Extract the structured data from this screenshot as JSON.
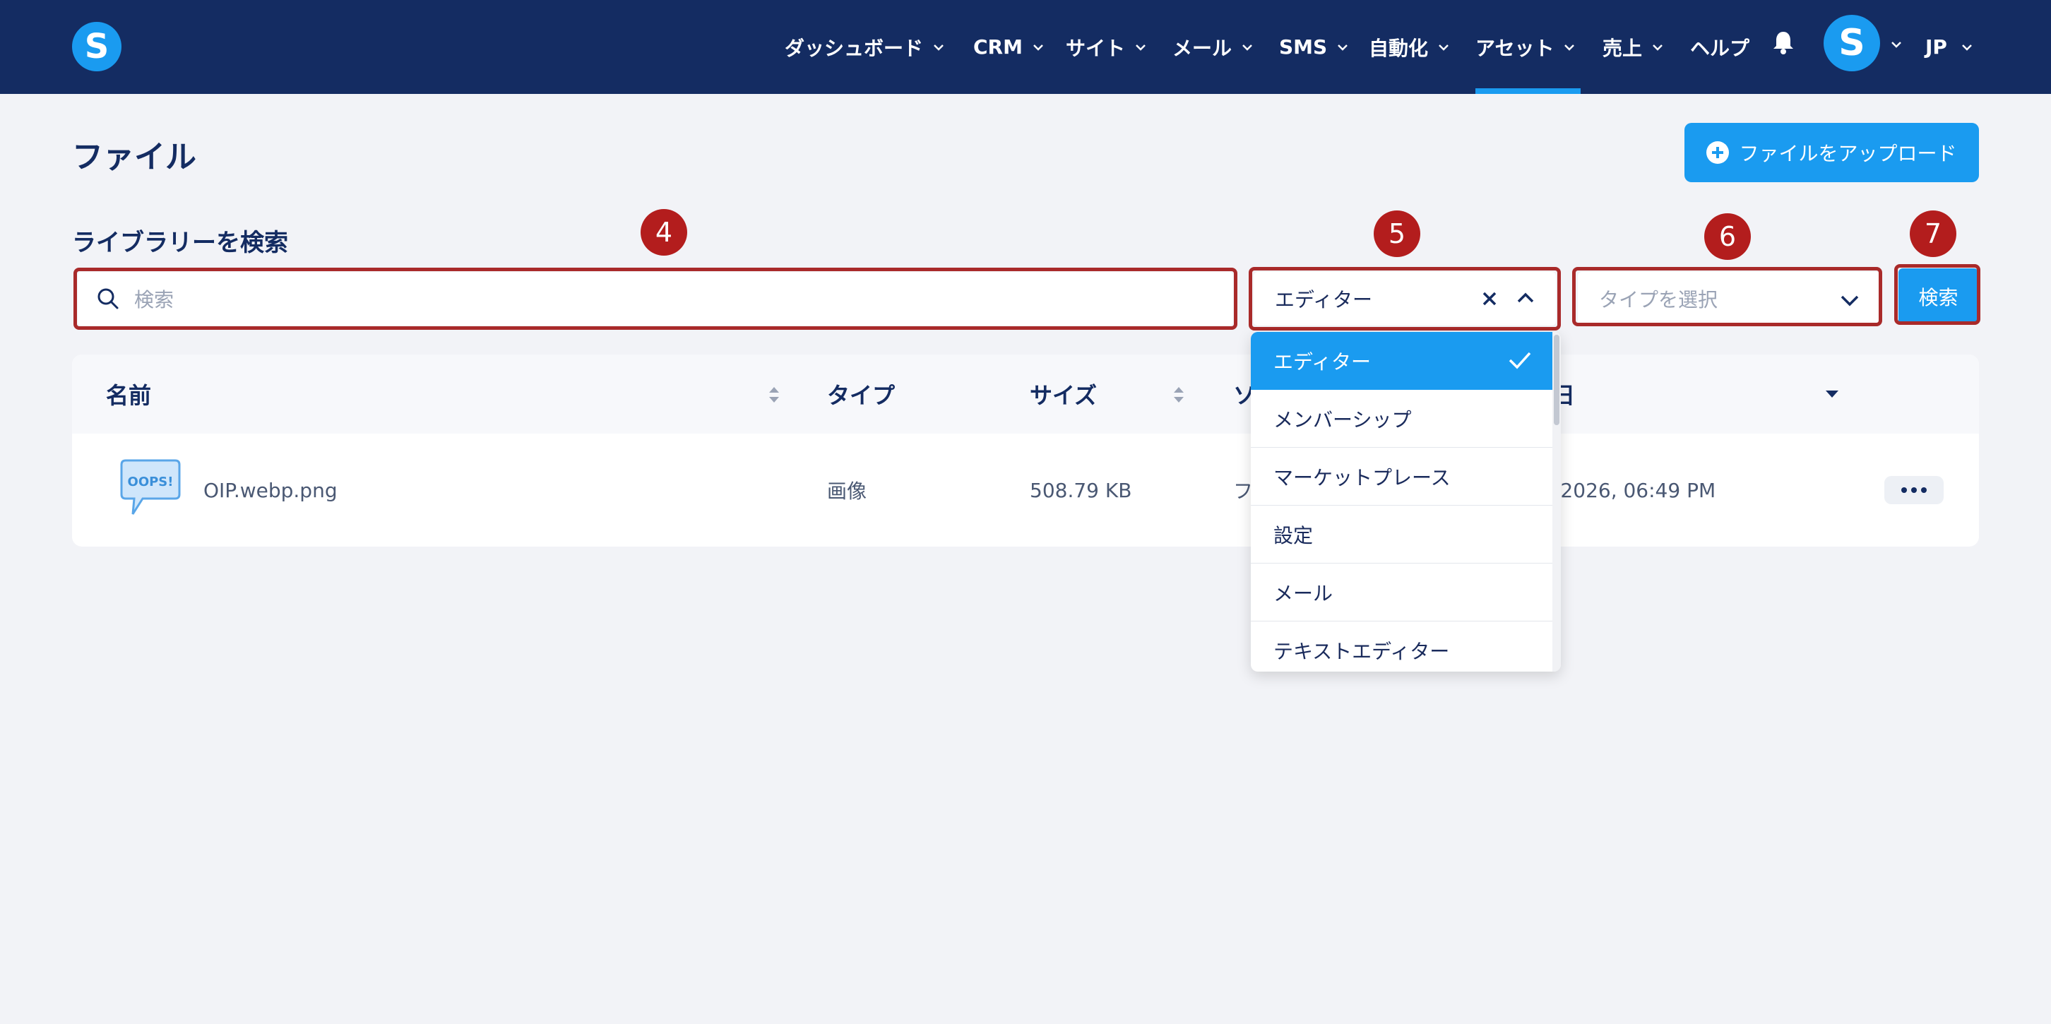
{
  "header": {
    "logo_letter": "S",
    "nav": [
      {
        "label": "ダッシュボード",
        "has_chevron": true
      },
      {
        "label": "CRM",
        "has_chevron": true
      },
      {
        "label": "サイト",
        "has_chevron": true
      },
      {
        "label": "メール",
        "has_chevron": true
      },
      {
        "label": "SMS",
        "has_chevron": true
      },
      {
        "label": "自動化",
        "has_chevron": true
      },
      {
        "label": "アセット",
        "has_chevron": true,
        "active": true
      },
      {
        "label": "売上",
        "has_chevron": true
      },
      {
        "label": "ヘルプ",
        "has_chevron": false
      }
    ],
    "notification_icon": "bell-icon",
    "avatar_letter": "S",
    "language": "JP",
    "accent_color": "#1a9bf0",
    "bar_color": "#142c62"
  },
  "page": {
    "title": "ファイル",
    "upload_button": "ファイルをアップロード",
    "search_label": "ライブラリーを検索"
  },
  "filters": {
    "search_placeholder": "検索",
    "category_value": "エディター",
    "type_placeholder": "タイプを選択",
    "search_button": "検索"
  },
  "markers": [
    "4",
    "5",
    "6",
    "7"
  ],
  "dropdown": {
    "options": [
      "エディター",
      "メンバーシップ",
      "マーケットプレース",
      "設定",
      "メール",
      "テキストエディター"
    ],
    "selected": "エディター"
  },
  "table": {
    "columns": [
      "名前",
      "タイプ",
      "サイズ",
      "ソ",
      "日"
    ],
    "rows": [
      {
        "name": "OIP.webp.png",
        "thumbnail_text": "OOPS!",
        "type": "画像",
        "size": "508.79 KB",
        "source": "フ",
        "date": "/2026, 06:49 PM"
      }
    ]
  }
}
